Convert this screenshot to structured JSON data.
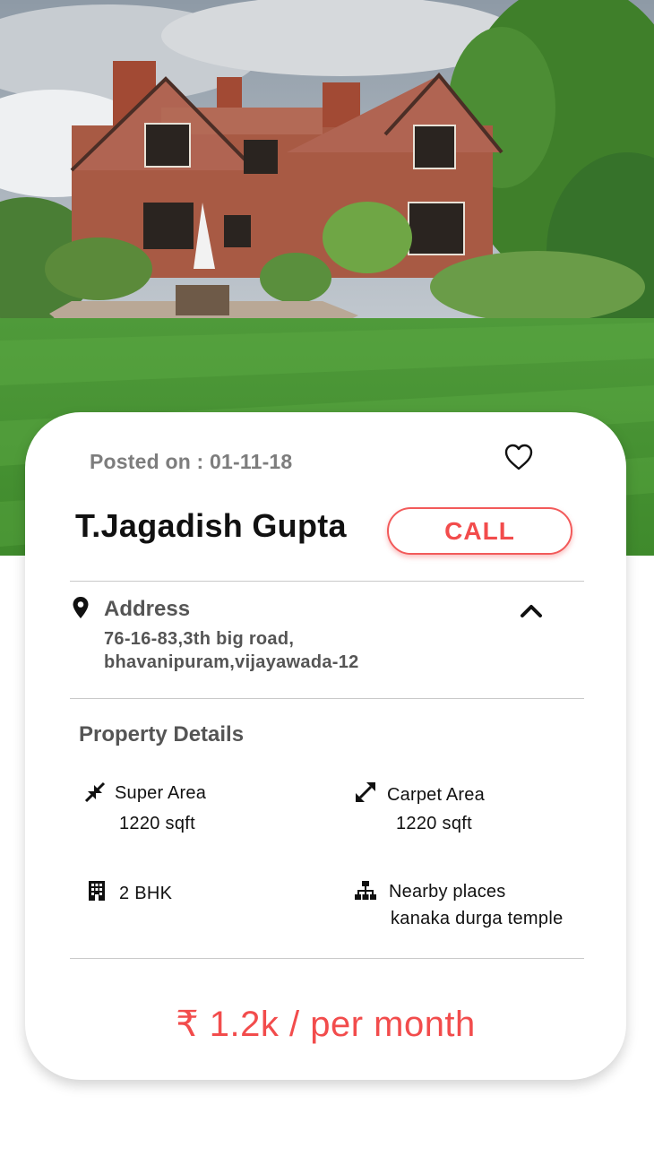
{
  "listing": {
    "posted_label": "Posted on : 01-11-18",
    "owner_name": "T.Jagadish Gupta",
    "call_label": "CALL",
    "favorite_icon": "heart-outline-icon"
  },
  "address": {
    "title": "Address",
    "line1": "76-16-83,3th big road,",
    "line2": "bhavanipuram,vijayawada-12",
    "icon": "map-pin-icon",
    "toggle_icon": "chevron-up-icon"
  },
  "property": {
    "title": "Property Details",
    "super_area_label": "Super Area",
    "super_area_value": "1220 sqft",
    "carpet_area_label": "Carpet Area",
    "carpet_area_value": "1220 sqft",
    "bhk": "2 BHK",
    "nearby_label": "Nearby places",
    "nearby_value": "kanaka durga temple"
  },
  "price": {
    "text": "₹ 1.2k / per month"
  },
  "colors": {
    "accent": "#f24c4c",
    "muted_text": "#7d7d7d",
    "divider": "#c9c9c9"
  }
}
